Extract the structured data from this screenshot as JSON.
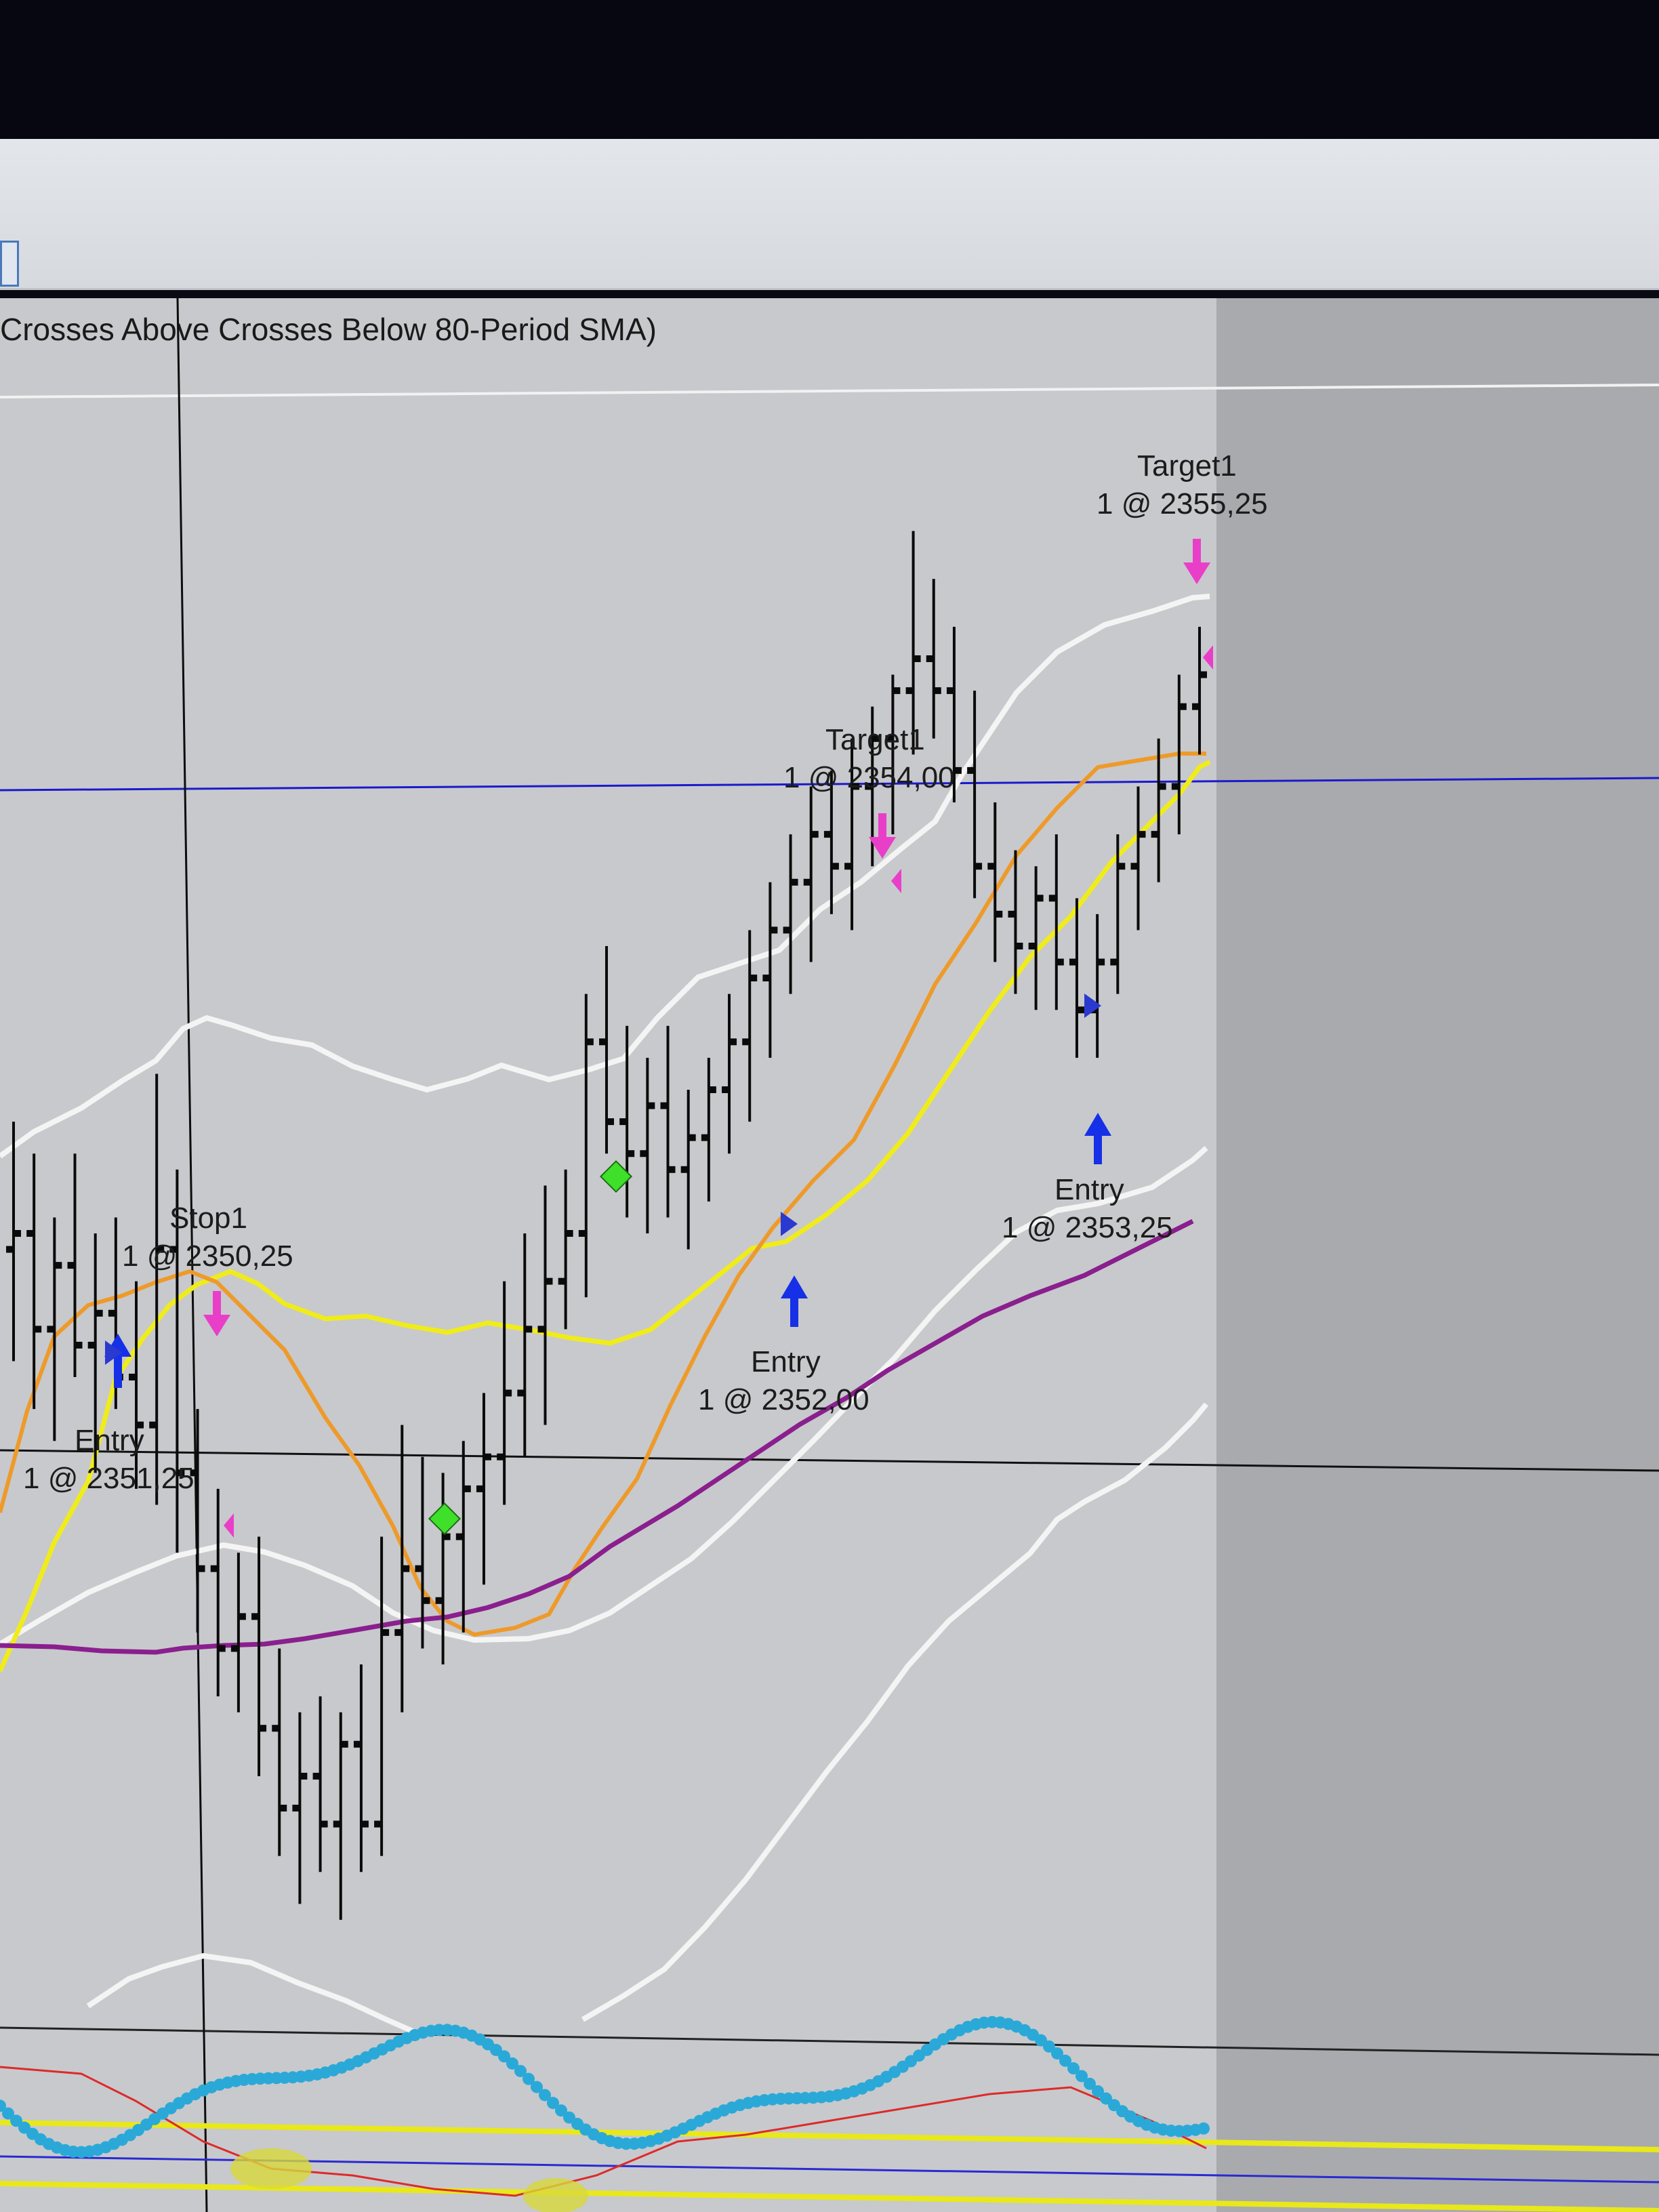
{
  "window": {
    "title": "Crosses Above Crosses Below 80-Period SMA)"
  },
  "colors": {
    "panel_bg": "#c8c9cc",
    "future_bg": "#a9aaad",
    "price_bars": "#0a0a0a",
    "bollinger": "#f4f4f4",
    "sma_fast": "#ee9a2a",
    "sma_mid": "#f0ec1a",
    "sma_80": "#8a1f8e",
    "h_line": "#1a1acc",
    "entry_arrow": "#1530e6",
    "exit_arrow": "#e93fc8",
    "signal_diamond": "#3ee02a",
    "osc_dots": "#2aa9d8",
    "osc_red": "#dd2a2a",
    "osc_level": "#e8e81a"
  },
  "chart_data": {
    "type": "ohlc",
    "title": "Crosses Above Crosses Below 80-Period SMA)",
    "bars_ohlc": [
      [
        2351.4,
        2352.2,
        2350.7,
        2351.5
      ],
      [
        2351.5,
        2352.0,
        2350.4,
        2350.9
      ],
      [
        2350.9,
        2351.6,
        2350.2,
        2351.3
      ],
      [
        2351.3,
        2352.0,
        2350.6,
        2350.8
      ],
      [
        2350.8,
        2351.5,
        2350.0,
        2351.0
      ],
      [
        2351.0,
        2351.6,
        2350.4,
        2350.6
      ],
      [
        2350.6,
        2351.2,
        2349.9,
        2350.3
      ],
      [
        2350.3,
        2352.5,
        2349.8,
        2351.4
      ],
      [
        2351.4,
        2351.9,
        2349.5,
        2350.0
      ],
      [
        2350.0,
        2350.4,
        2349.0,
        2349.4
      ],
      [
        2349.4,
        2349.9,
        2348.6,
        2348.9
      ],
      [
        2348.9,
        2349.5,
        2348.5,
        2349.1
      ],
      [
        2349.1,
        2349.6,
        2348.1,
        2348.4
      ],
      [
        2348.4,
        2348.9,
        2347.6,
        2347.9
      ],
      [
        2347.9,
        2348.5,
        2347.3,
        2348.1
      ],
      [
        2348.1,
        2348.6,
        2347.5,
        2347.8
      ],
      [
        2347.8,
        2348.5,
        2347.2,
        2348.3
      ],
      [
        2348.3,
        2348.8,
        2347.5,
        2347.8
      ],
      [
        2347.8,
        2349.6,
        2347.6,
        2349.0
      ],
      [
        2349.0,
        2350.3,
        2348.5,
        2349.4
      ],
      [
        2349.4,
        2350.1,
        2348.9,
        2349.2
      ],
      [
        2349.2,
        2350.0,
        2348.8,
        2349.6
      ],
      [
        2349.6,
        2350.2,
        2349.0,
        2349.9
      ],
      [
        2349.9,
        2350.5,
        2349.3,
        2350.1
      ],
      [
        2350.1,
        2351.2,
        2349.8,
        2350.5
      ],
      [
        2350.5,
        2351.5,
        2350.1,
        2350.9
      ],
      [
        2350.9,
        2351.8,
        2350.3,
        2351.2
      ],
      [
        2351.2,
        2351.9,
        2350.9,
        2351.5
      ],
      [
        2351.5,
        2353.0,
        2351.1,
        2352.7
      ],
      [
        2352.7,
        2353.3,
        2352.0,
        2352.2
      ],
      [
        2352.2,
        2352.8,
        2351.6,
        2352.0
      ],
      [
        2352.0,
        2352.6,
        2351.5,
        2352.3
      ],
      [
        2352.3,
        2352.8,
        2351.6,
        2351.9
      ],
      [
        2351.9,
        2352.4,
        2351.4,
        2352.1
      ],
      [
        2352.1,
        2352.6,
        2351.7,
        2352.4
      ],
      [
        2352.4,
        2353.0,
        2352.0,
        2352.7
      ],
      [
        2352.7,
        2353.4,
        2352.2,
        2353.1
      ],
      [
        2353.1,
        2353.7,
        2352.6,
        2353.4
      ],
      [
        2353.4,
        2354.0,
        2353.0,
        2353.7
      ],
      [
        2353.7,
        2354.3,
        2353.2,
        2354.0
      ],
      [
        2354.0,
        2354.4,
        2353.5,
        2353.8
      ],
      [
        2353.8,
        2354.6,
        2353.4,
        2354.3
      ],
      [
        2354.3,
        2354.8,
        2353.8,
        2354.6
      ],
      [
        2354.6,
        2355.0,
        2354.0,
        2354.9
      ],
      [
        2354.9,
        2355.9,
        2354.5,
        2355.1
      ],
      [
        2355.1,
        2355.6,
        2354.6,
        2354.9
      ],
      [
        2354.9,
        2355.3,
        2354.2,
        2354.4
      ],
      [
        2354.4,
        2354.9,
        2353.6,
        2353.8
      ],
      [
        2353.8,
        2354.2,
        2353.2,
        2353.5
      ],
      [
        2353.5,
        2353.9,
        2353.0,
        2353.3
      ],
      [
        2353.3,
        2353.8,
        2352.9,
        2353.6
      ],
      [
        2353.6,
        2354.0,
        2352.9,
        2353.2
      ],
      [
        2353.2,
        2353.6,
        2352.6,
        2352.9
      ],
      [
        2352.9,
        2353.5,
        2352.6,
        2353.2
      ],
      [
        2353.2,
        2354.0,
        2353.0,
        2353.8
      ],
      [
        2353.8,
        2354.3,
        2353.4,
        2354.0
      ],
      [
        2354.0,
        2354.6,
        2353.7,
        2354.3
      ],
      [
        2354.3,
        2355.0,
        2354.0,
        2354.8
      ],
      [
        2354.8,
        2355.3,
        2354.5,
        2355.0
      ]
    ],
    "annotations": [
      {
        "kind": "stop",
        "text": "Stop1",
        "sub": "1 @ 2350,25"
      },
      {
        "kind": "entry",
        "text": "Entry",
        "sub": "1 @ 2351,25"
      },
      {
        "kind": "entry",
        "text": "Entry",
        "sub": "1 @ 2352,00"
      },
      {
        "kind": "target",
        "text": "Target1",
        "sub": "1 @ 2354,00"
      },
      {
        "kind": "target",
        "text": "Target1",
        "sub": "1 @ 2355,25"
      },
      {
        "kind": "entry",
        "text": "Entry",
        "sub": "1 @ 2353,25"
      }
    ]
  }
}
